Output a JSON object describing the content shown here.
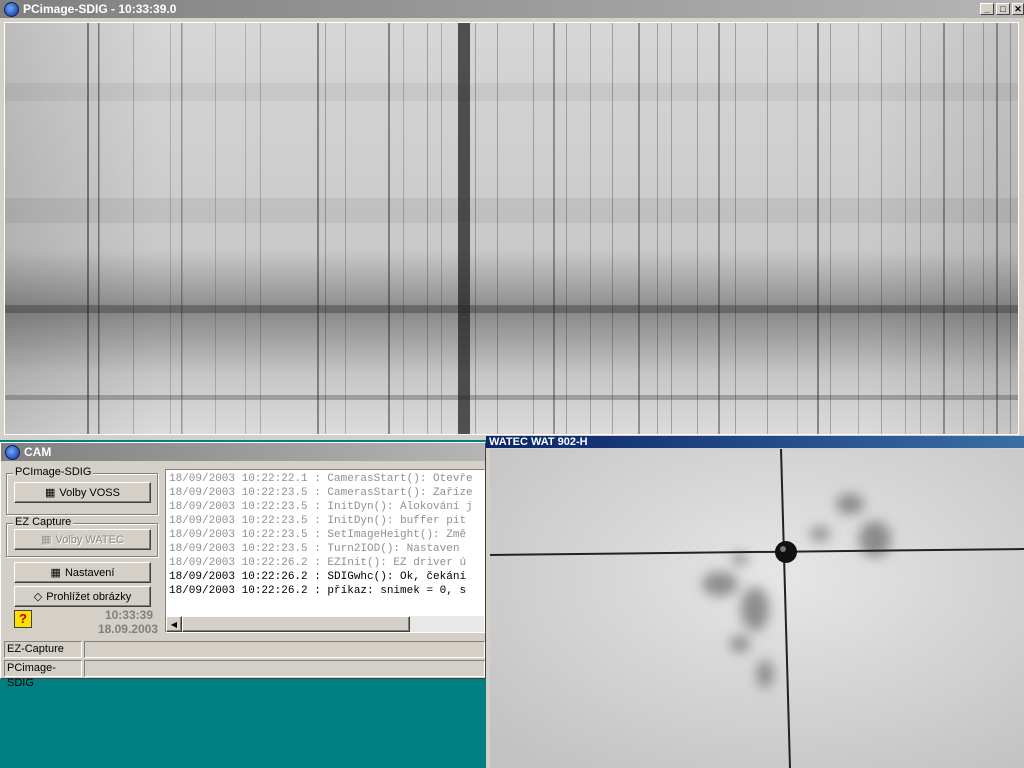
{
  "main_window": {
    "title": "PCimage-SDIG - 10:33:39.0",
    "buttons": {
      "minimize": "_",
      "maximize": "□",
      "close": "✕"
    }
  },
  "cam_window": {
    "title": "CAM",
    "groups": {
      "pcimage": {
        "legend": "PCImage-SDIG",
        "button": "Volby VOSS"
      },
      "ez": {
        "legend": "EZ Capture",
        "button": "Volby WATEC"
      }
    },
    "buttons": {
      "settings": "Nastavení",
      "browse": "Prohlížet obrázky"
    },
    "help_icon": "?",
    "clock": {
      "time": "10:33:39",
      "date": "18.09.2003"
    },
    "log": [
      {
        "text": "18/09/2003 10:22:22.1 : CamerasStart(): Otevře",
        "dim": true
      },
      {
        "text": "18/09/2003 10:22:23.5 : CamerasStart(): Zaříze",
        "dim": true
      },
      {
        "text": "18/09/2003 10:22:23.5 : InitDyn(): Alokování j",
        "dim": true
      },
      {
        "text": "18/09/2003 10:22:23.5 : InitDyn(): buffer pit",
        "dim": true
      },
      {
        "text": "18/09/2003 10:22:23.5 : SetImageHeight(): Změ",
        "dim": true
      },
      {
        "text": "18/09/2003 10:22:23.5 : Turn2IOD(): Nastaven ",
        "dim": true
      },
      {
        "text": "18/09/2003 10:22:26.2 : EZInit(): EZ driver ú",
        "dim": true
      },
      {
        "text": "18/09/2003 10:22:26.2 : SDIGwhc(): Ok, čekání",
        "dim": false
      },
      {
        "text": "18/09/2003 10:22:26.2 : příkaz: snimek = 0, s",
        "dim": false
      }
    ],
    "status": [
      {
        "label": "EZ-Capture",
        "value": ""
      },
      {
        "label": "PCimage-SDIG",
        "value": ""
      }
    ]
  },
  "watec_window": {
    "title": "WATEC WAT 902-H"
  }
}
